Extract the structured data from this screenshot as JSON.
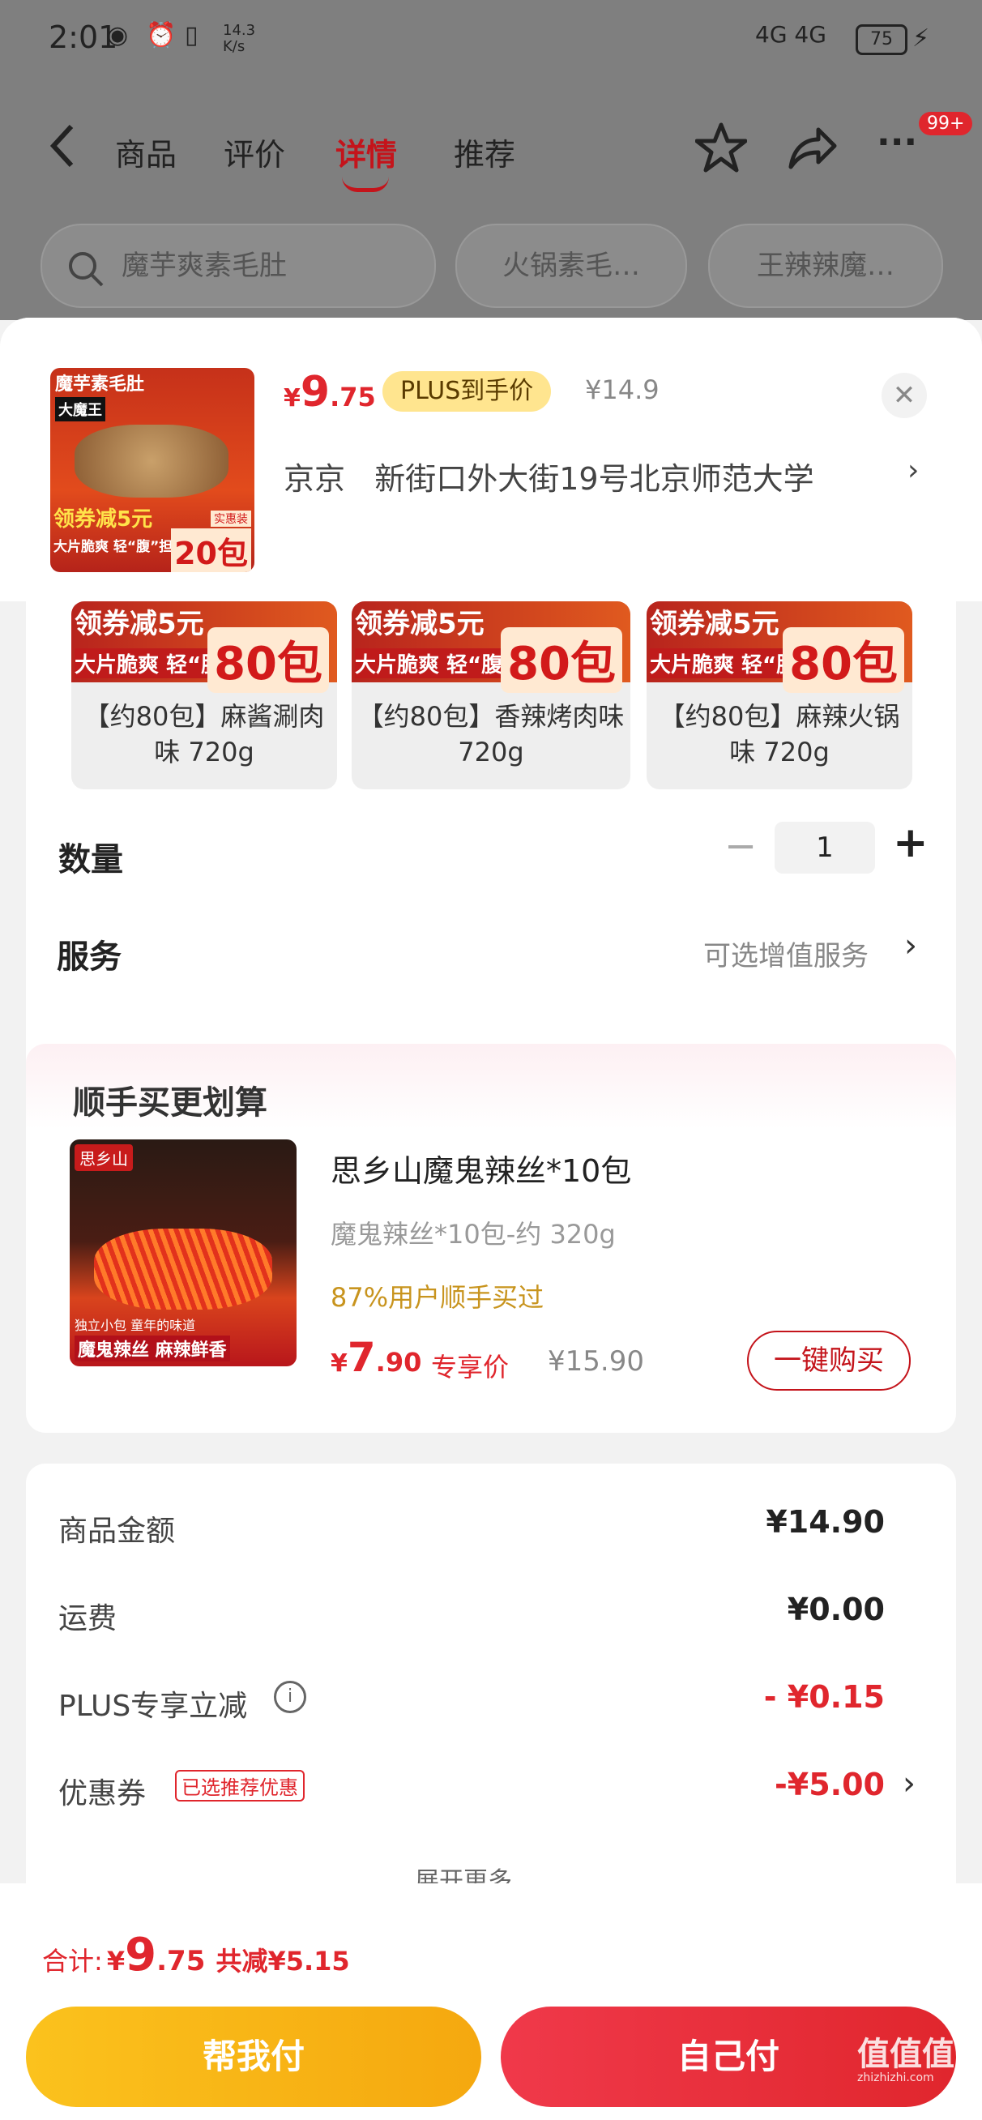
{
  "status_bar": {
    "time": "2:01",
    "speed": "14.3\nK/s",
    "network": "4G 4G",
    "battery": "75"
  },
  "nav": {
    "tabs": [
      "商品",
      "评价",
      "详情",
      "推荐"
    ],
    "active_tab": "详情",
    "badge": "99+"
  },
  "search": {
    "query": "魔芋爽素毛肚",
    "suggestions": [
      "火锅素毛…",
      "王辣辣魔…"
    ]
  },
  "product": {
    "price_symbol": "¥",
    "price_int": "9",
    "price_dec": ".75",
    "plus_tag": "PLUS到手价",
    "orig_price": "¥14.9",
    "address": "京京   新街口外大街19号北京师范大学",
    "thumb_top": "魔芋素毛肚",
    "thumb_brand": "大魔王",
    "thumb_coupon": "领券减5元",
    "thumb_slogan": "大片脆爽 轻“腹”担",
    "thumb_count": "20包",
    "thumb_count_label": "实惠装"
  },
  "variants": [
    {
      "banner": "领券减5元",
      "slogan": "大片脆爽 轻“腹”担",
      "count": "80包",
      "name": "【约80包】麻酱涮肉味 720g"
    },
    {
      "banner": "领券减5元",
      "slogan": "大片脆爽 轻“腹”担",
      "count": "80包",
      "name": "【约80包】香辣烤肉味 720g"
    },
    {
      "banner": "领券减5元",
      "slogan": "大片脆爽 轻“腹”担",
      "count": "80包",
      "name": "【约80包】麻辣火锅味 720g"
    }
  ],
  "quantity": {
    "label": "数量",
    "value": "1",
    "minus": "−",
    "plus": "+"
  },
  "service": {
    "label": "服务",
    "value": "可选增值服务"
  },
  "addon": {
    "title": "顺手买更划算",
    "name": "思乡山魔鬼辣丝*10包",
    "spec": "魔鬼辣丝*10包-约 320g",
    "social": "87%用户顺手买过",
    "price_int": "7",
    "price_dec": ".90",
    "price_symbol": "¥",
    "price_label": "专享价",
    "orig_price": "¥15.90",
    "buy_button": "一键购买",
    "thumb_brand": "思乡山",
    "thumb_tag1": "独立小包 童年的味道",
    "thumb_tag2": "魔鬼辣丝 麻辣鲜香"
  },
  "summary": {
    "rows": [
      {
        "label": "商品金额",
        "value": "¥14.90"
      },
      {
        "label": "运费",
        "value": "¥0.00"
      },
      {
        "label": "PLUS专享立减",
        "value": "- ¥0.15"
      },
      {
        "label": "优惠券",
        "value": "-¥5.00",
        "tag": "已选推荐优惠"
      }
    ],
    "expand": "展开更多"
  },
  "footer": {
    "total_label": "合计:",
    "total_symbol": "¥",
    "total_int": "9",
    "total_dec": ".75",
    "saved": "共减¥5.15",
    "help_pay": "帮我付",
    "self_pay": "自己付",
    "watermark": "值值值",
    "watermark_sub": "zhizhizhi.com"
  },
  "colors": {
    "accent": "#e0262d",
    "gold": "#f9c91e",
    "plus": "#ffe58f"
  }
}
